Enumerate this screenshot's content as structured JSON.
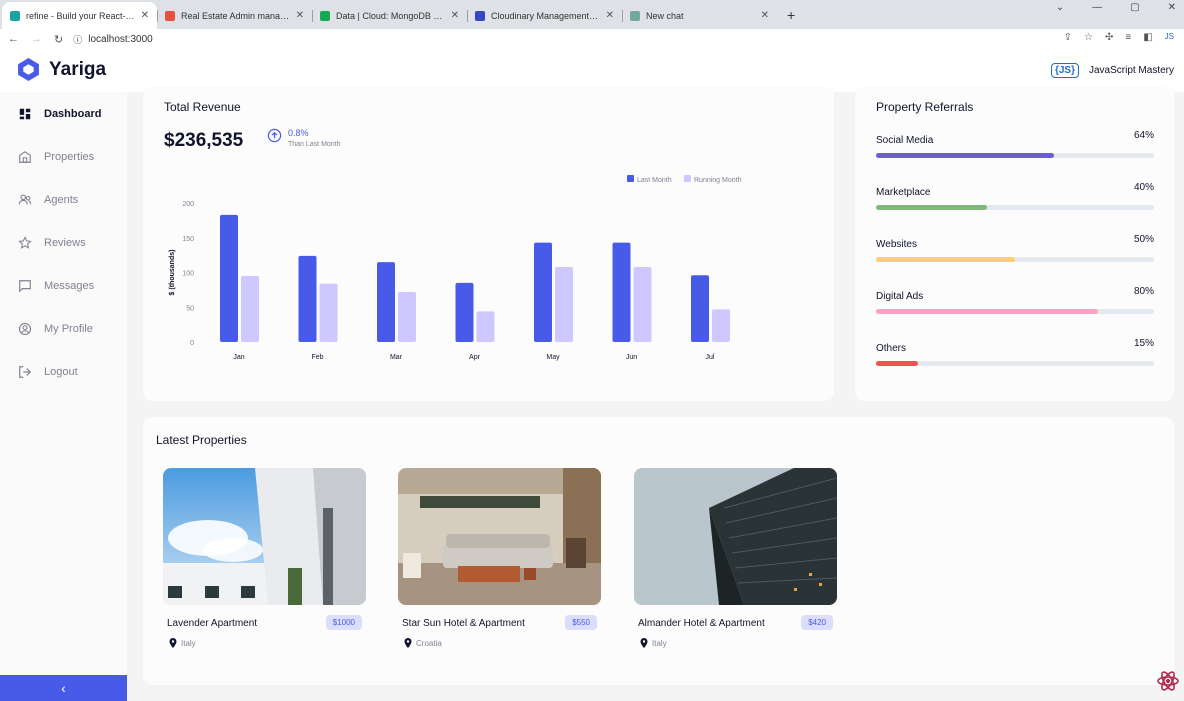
{
  "browser": {
    "tabs": [
      {
        "title": "refine - Build your React-based C",
        "active": true,
        "favicon_color": "#1aa3a3"
      },
      {
        "title": "Real Estate Admin management",
        "active": false,
        "favicon_color": "#e8513f"
      },
      {
        "title": "Data | Cloud: MongoDB Cloud",
        "active": false,
        "favicon_color": "#13aa52"
      },
      {
        "title": "Cloudinary Management Console",
        "active": false,
        "favicon_color": "#3448c5"
      },
      {
        "title": "New chat",
        "active": false,
        "favicon_color": "#74aa9c"
      }
    ],
    "url": "localhost:3000"
  },
  "app": {
    "name": "Yariga",
    "user_name": "JavaScript Mastery",
    "user_badge": "{JS}",
    "accent": "#475be8"
  },
  "sidebar": {
    "items": [
      {
        "label": "Dashboard",
        "icon": "dashboard-icon",
        "active": true
      },
      {
        "label": "Properties",
        "icon": "properties-icon",
        "active": false
      },
      {
        "label": "Agents",
        "icon": "agents-icon",
        "active": false
      },
      {
        "label": "Reviews",
        "icon": "star-icon",
        "active": false
      },
      {
        "label": "Messages",
        "icon": "message-icon",
        "active": false
      },
      {
        "label": "My Profile",
        "icon": "profile-icon",
        "active": false
      }
    ],
    "logout_label": "Logout",
    "collapse_icon": "‹"
  },
  "revenue": {
    "title": "Total Revenue",
    "amount": "$236,535",
    "change_pct": "0.8%",
    "change_label": "Than Last Month"
  },
  "chart_data": {
    "type": "bar",
    "categories": [
      "Jan",
      "Feb",
      "Mar",
      "Apr",
      "May",
      "Jun",
      "Jul"
    ],
    "series": [
      {
        "name": "Last Month",
        "color": "#475be8",
        "values": [
          183,
          124,
          115,
          85,
          143,
          143,
          96
        ]
      },
      {
        "name": "Running Month",
        "color": "#cfc8ff",
        "values": [
          95,
          84,
          72,
          44,
          108,
          108,
          47
        ]
      }
    ],
    "ylabel": "$ (thousands)",
    "yticks": [
      0,
      50,
      100,
      150,
      200
    ],
    "ylim": [
      0,
      200
    ],
    "grid": false,
    "legend_position": "top-right"
  },
  "referrals": {
    "title": "Property Referrals",
    "items": [
      {
        "label": "Social Media",
        "value": "64%",
        "percent": 64,
        "color": "#6c5dd3"
      },
      {
        "label": "Marketplace",
        "value": "40%",
        "percent": 40,
        "color": "#7fba7a"
      },
      {
        "label": "Websites",
        "value": "50%",
        "percent": 50,
        "color": "#ffce73"
      },
      {
        "label": "Digital Ads",
        "value": "80%",
        "percent": 80,
        "color": "#ffa2c0"
      },
      {
        "label": "Others",
        "value": "15%",
        "percent": 15,
        "color": "#f45252"
      }
    ]
  },
  "latest": {
    "title": "Latest Properties",
    "properties": [
      {
        "name": "Lavender Apartment",
        "price": "$1000",
        "location": "Italy"
      },
      {
        "name": "Star Sun Hotel & Apartment",
        "price": "$550",
        "location": "Croatia"
      },
      {
        "name": "Almander Hotel & Apartment",
        "price": "$420",
        "location": "Italy"
      }
    ]
  }
}
